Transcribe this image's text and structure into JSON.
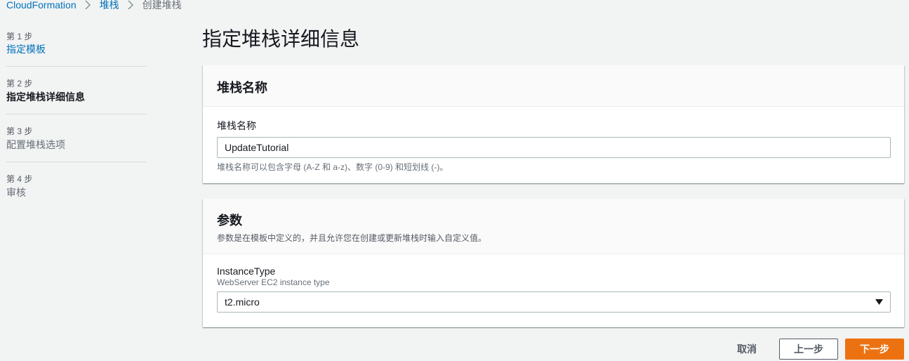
{
  "breadcrumb": {
    "items": [
      {
        "label": "CloudFormation"
      },
      {
        "label": "堆栈"
      },
      {
        "label": "创建堆栈"
      }
    ]
  },
  "steps": [
    {
      "number": "第 1 步",
      "label": "指定模板",
      "state": "link"
    },
    {
      "number": "第 2 步",
      "label": "指定堆栈详细信息",
      "state": "active"
    },
    {
      "number": "第 3 步",
      "label": "配置堆栈选项",
      "state": "disabled"
    },
    {
      "number": "第 4 步",
      "label": "审核",
      "state": "disabled"
    }
  ],
  "page": {
    "title": "指定堆栈详细信息"
  },
  "stack_name_panel": {
    "title": "堆栈名称",
    "field_label": "堆栈名称",
    "value": "UpdateTutorial",
    "constraint": "堆栈名称可以包含字母 (A-Z 和 a-z)、数字 (0-9) 和短划线 (-)。"
  },
  "parameters_panel": {
    "title": "参数",
    "description": "参数是在模板中定义的，并且允许您在创建或更新堆栈时输入自定义值。",
    "field_label": "InstanceType",
    "field_description": "WebServer EC2 instance type",
    "selected_value": "t2.micro"
  },
  "actions": {
    "cancel_label": "取消",
    "previous_label": "上一步",
    "next_label": "下一步"
  },
  "colors": {
    "link": "#0073bb",
    "primary_button": "#ec7211",
    "background": "#f2f3f3"
  },
  "icons": {
    "breadcrumb_separator": "chevron-right-icon",
    "select_caret": "caret-down-icon"
  }
}
